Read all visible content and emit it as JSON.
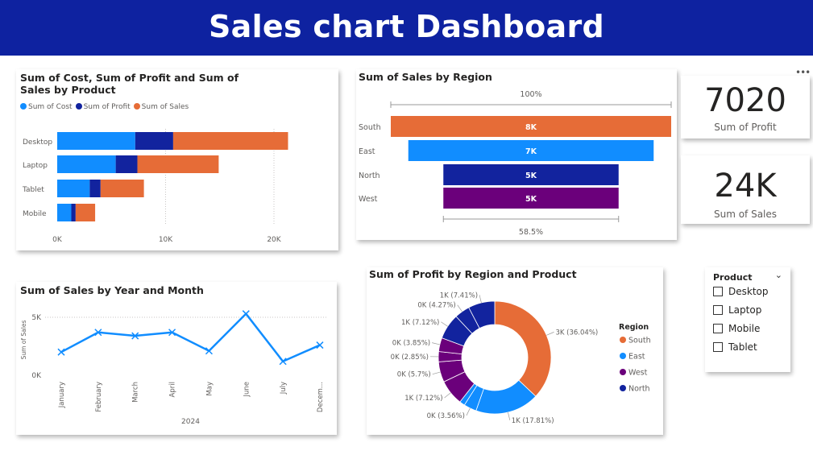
{
  "header": {
    "title": "Sales chart Dashboard"
  },
  "colors": {
    "header_bg": "#0e22a0",
    "cost": "#118dff",
    "profit": "#12239e",
    "sales": "#e66c37",
    "south": "#e66c37",
    "east": "#118dff",
    "north": "#12239e",
    "west": "#6b007b",
    "line": "#118dff"
  },
  "icons": {
    "more": "more-options-icon",
    "chevron": "chevron-down-icon"
  },
  "kpi_profit": {
    "value": "7020",
    "label": "Sum of Profit"
  },
  "kpi_sales": {
    "value": "24K",
    "label": "Sum of Sales"
  },
  "slicer": {
    "title": "Product",
    "items": [
      "Desktop",
      "Laptop",
      "Mobile",
      "Tablet"
    ]
  },
  "chart_data": [
    {
      "type": "bar",
      "title": "Sum of Cost, Sum of Profit and Sum of Sales by Product",
      "orientation": "horizontal",
      "stacked": true,
      "categories": [
        "Desktop",
        "Laptop",
        "Tablet",
        "Mobile"
      ],
      "series": [
        {
          "name": "Sum of Cost",
          "values": [
            7200,
            5400,
            3000,
            1300
          ]
        },
        {
          "name": "Sum of Profit",
          "values": [
            3500,
            2000,
            1000,
            400
          ]
        },
        {
          "name": "Sum of Sales",
          "values": [
            10600,
            7500,
            4000,
            1800
          ]
        }
      ],
      "xticks": [
        "0K",
        "10K",
        "20K"
      ],
      "xlim": [
        0,
        20000
      ],
      "legend": "top-left",
      "grid": true
    },
    {
      "type": "bar",
      "subtype": "funnel",
      "title": "Sum of Sales by Region",
      "categories": [
        "South",
        "East",
        "North",
        "West"
      ],
      "values": [
        8000,
        7000,
        5000,
        5000
      ],
      "data_labels": [
        "8K",
        "7K",
        "5K",
        "5K"
      ],
      "top_label": "100%",
      "bottom_label": "58.5%"
    },
    {
      "type": "line",
      "title": "Sum of Sales by Year and Month",
      "x": [
        "January",
        "February",
        "March",
        "April",
        "May",
        "June",
        "July",
        "Decem..."
      ],
      "values": [
        2000,
        3700,
        3400,
        3700,
        2100,
        5300,
        1200,
        2600
      ],
      "ylabel": "Sum of Sales",
      "xlabel": "2024",
      "yticks": [
        "0K",
        "5K"
      ],
      "ylim": [
        0,
        5000
      ],
      "grid": true
    },
    {
      "type": "pie",
      "subtype": "donut",
      "title": "Sum of Profit by Region and Product",
      "legend_title": "Region",
      "legend": [
        "South",
        "East",
        "West",
        "North"
      ],
      "legend_position": "right",
      "slices": [
        {
          "region": "South",
          "value": 36.04,
          "label": "3K (36.04%)"
        },
        {
          "region": "East",
          "value": 17.81,
          "label": "1K (17.81%)"
        },
        {
          "region": "East",
          "value": 3.56,
          "label": "0K (3.56%)"
        },
        {
          "region": "East",
          "value": 1.5,
          "label": ""
        },
        {
          "region": "West",
          "value": 7.12,
          "label": "1K (7.12%)"
        },
        {
          "region": "West",
          "value": 5.7,
          "label": "0K (5.7%)"
        },
        {
          "region": "West",
          "value": 2.85,
          "label": "0K (2.85%)"
        },
        {
          "region": "West",
          "value": 3.85,
          "label": "0K (3.85%)"
        },
        {
          "region": "North",
          "value": 7.12,
          "label": "1K (7.12%)"
        },
        {
          "region": "North",
          "value": 4.27,
          "label": "0K (4.27%)"
        },
        {
          "region": "North",
          "value": 7.41,
          "label": "1K (7.41%)"
        }
      ]
    }
  ]
}
